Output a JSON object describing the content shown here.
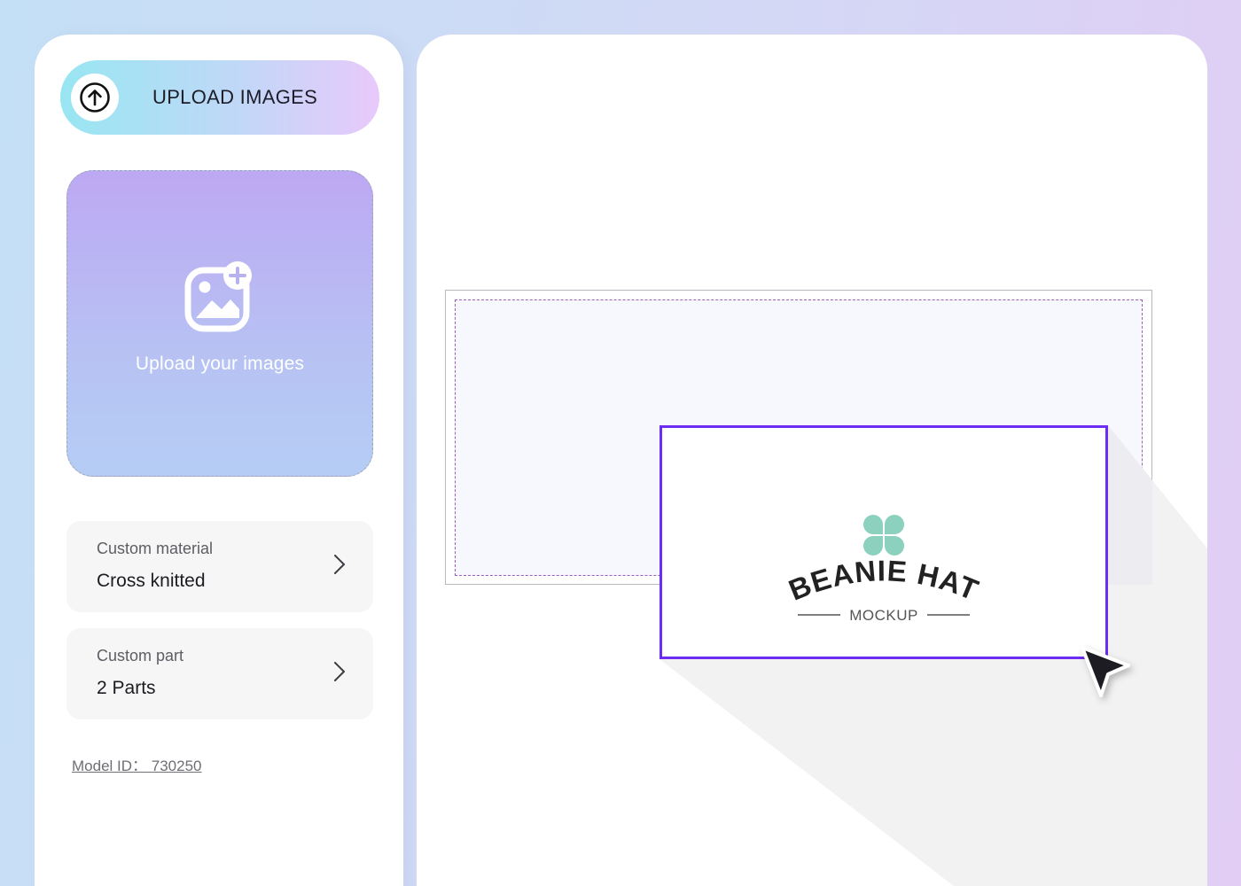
{
  "sidebar": {
    "upload_button": {
      "label": "UPLOAD IMAGES",
      "icon": "arrow-up-circle-icon"
    },
    "dropzone": {
      "text": "Upload your images",
      "icon": "add-image-icon"
    },
    "options": [
      {
        "label": "Custom material",
        "value": "Cross knitted",
        "icon": "chevron-right-icon"
      },
      {
        "label": "Custom part",
        "value": "2 Parts",
        "icon": "chevron-right-icon"
      }
    ],
    "model_id": "Model ID： 730250"
  },
  "canvas": {
    "mockup": {
      "title": "BEANIE HAT",
      "subtitle": "MOCKUP",
      "logo": "clover-logo",
      "accent_color": "#6c2cf2",
      "logo_color": "#8bd1bd"
    },
    "cursor_icon": "pointer-cursor-icon"
  }
}
